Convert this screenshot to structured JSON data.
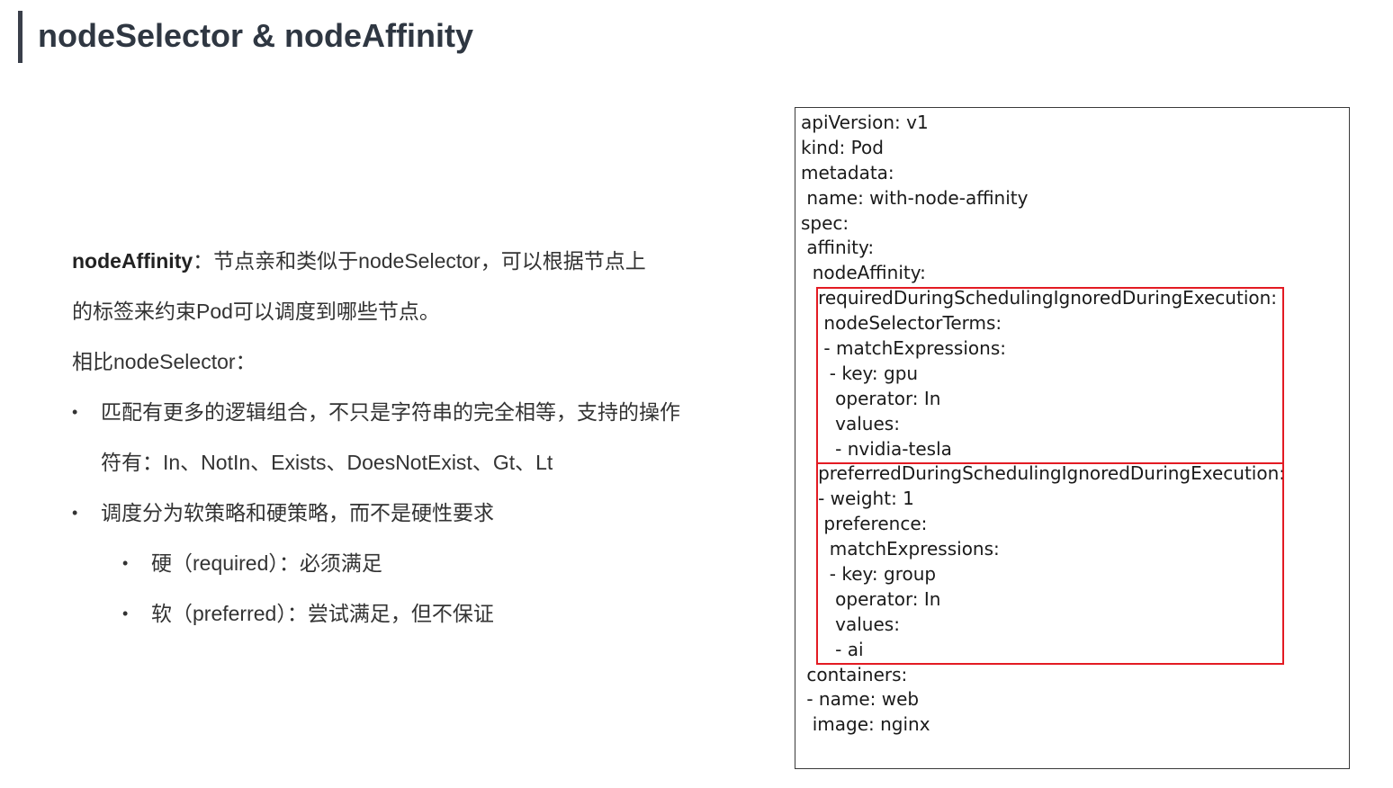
{
  "header": {
    "title": "nodeSelector & nodeAffinity"
  },
  "left": {
    "intro_strong": "nodeAffinity",
    "intro_rest": "：节点亲和类似于nodeSelector，可以根据节点上",
    "intro_line2": "的标签来约束Pod可以调度到哪些节点。",
    "compare_label": "相比nodeSelector：",
    "bullets": [
      {
        "line1": "匹配有更多的逻辑组合，不只是字符串的完全相等，支持的操作",
        "line2": "符有：In、NotIn、Exists、DoesNotExist、Gt、Lt"
      },
      {
        "line1": "调度分为软策略和硬策略，而不是硬性要求"
      }
    ],
    "sub_bullets": [
      "硬（required）：必须满足",
      "软（preferred）：尝试满足，但不保证"
    ],
    "bullet_glyph": "•"
  },
  "code": {
    "lines": [
      "apiVersion: v1",
      "kind: Pod",
      "metadata:",
      " name: with-node-affinity",
      "spec:",
      " affinity:",
      "  nodeAffinity:",
      "   requiredDuringSchedulingIgnoredDuringExecution:",
      "    nodeSelectorTerms:",
      "    - matchExpressions:",
      "     - key: gpu",
      "      operator: In",
      "      values:",
      "      - nvidia-tesla",
      "   preferredDuringSchedulingIgnoredDuringExecution:",
      "   - weight: 1",
      "    preference:",
      "     matchExpressions:",
      "     - key: group",
      "      operator: In",
      "      values:",
      "      - ai",
      " containers:",
      " - name: web",
      "  image: nginx"
    ]
  },
  "colors": {
    "highlight_border": "#e31b23",
    "title_bar": "#3a3f4a"
  }
}
